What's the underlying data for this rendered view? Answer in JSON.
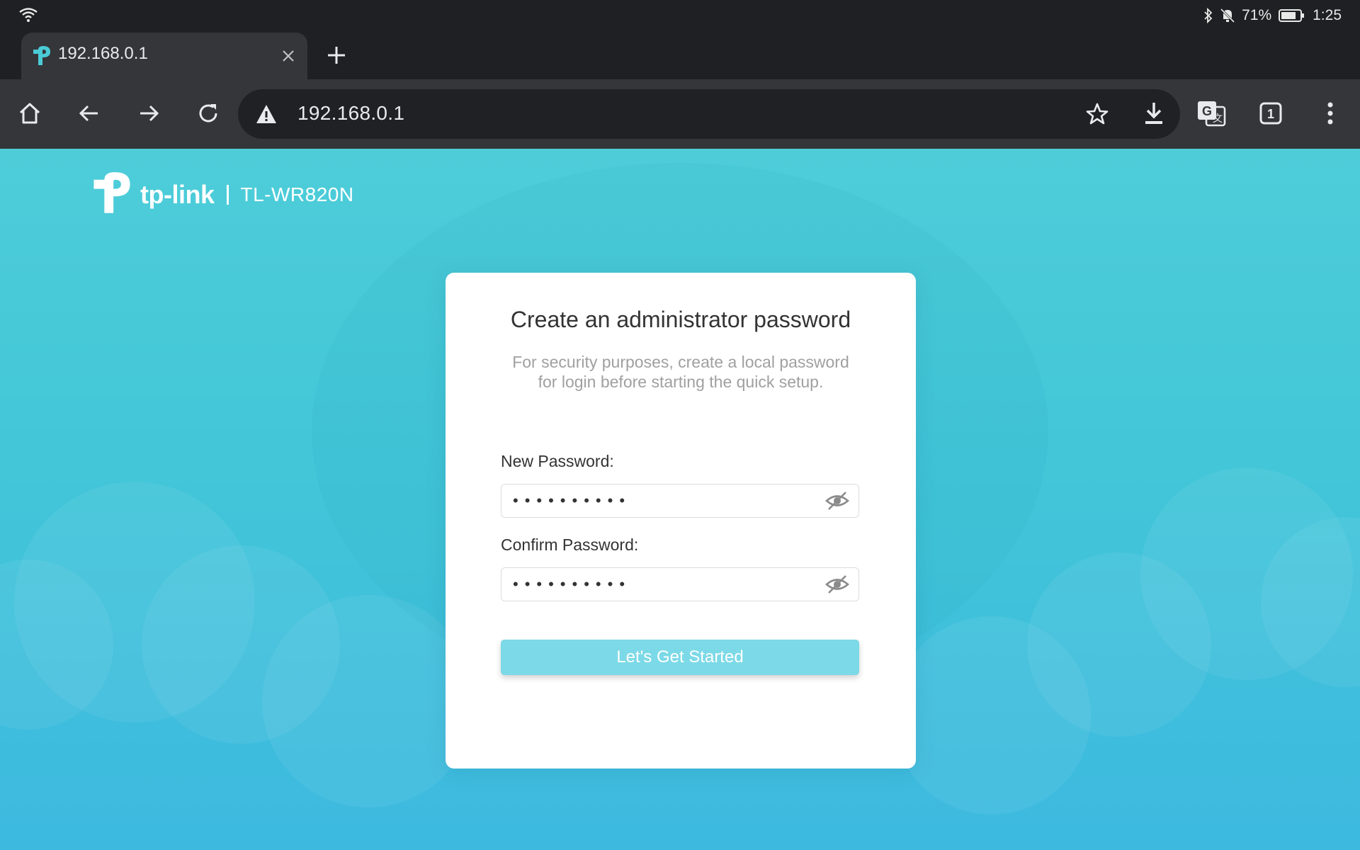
{
  "status_bar": {
    "battery": "71%",
    "time": "1:25"
  },
  "browser": {
    "tab": {
      "title": "192.168.0.1"
    },
    "address_bar": {
      "url": "192.168.0.1"
    },
    "tab_count": "1"
  },
  "page": {
    "brand": {
      "logo_text": "tp-link",
      "model": "TL-WR820N"
    },
    "card": {
      "title": "Create an administrator password",
      "description": "For security purposes, create a local password for login before starting the quick setup.",
      "new_password_label": "New Password:",
      "new_password_value": "••••••••••",
      "confirm_password_label": "Confirm Password:",
      "confirm_password_value": "••••••••••",
      "submit_label": "Let's Get Started"
    }
  },
  "colors": {
    "page_background": "#4ecdd9",
    "button": "#7cd9e7",
    "browser_toolbar": "#35363a"
  },
  "icons": [
    "wifi-icon",
    "bluetooth-icon",
    "bell-muted-icon",
    "battery-icon",
    "tplink-favicon",
    "close-icon",
    "plus-icon",
    "home-icon",
    "back-icon",
    "forward-icon",
    "reload-icon",
    "warning-icon",
    "star-icon",
    "download-icon",
    "translate-icon",
    "tab-switcher-icon",
    "menu-icon",
    "eye-slash-icon"
  ]
}
